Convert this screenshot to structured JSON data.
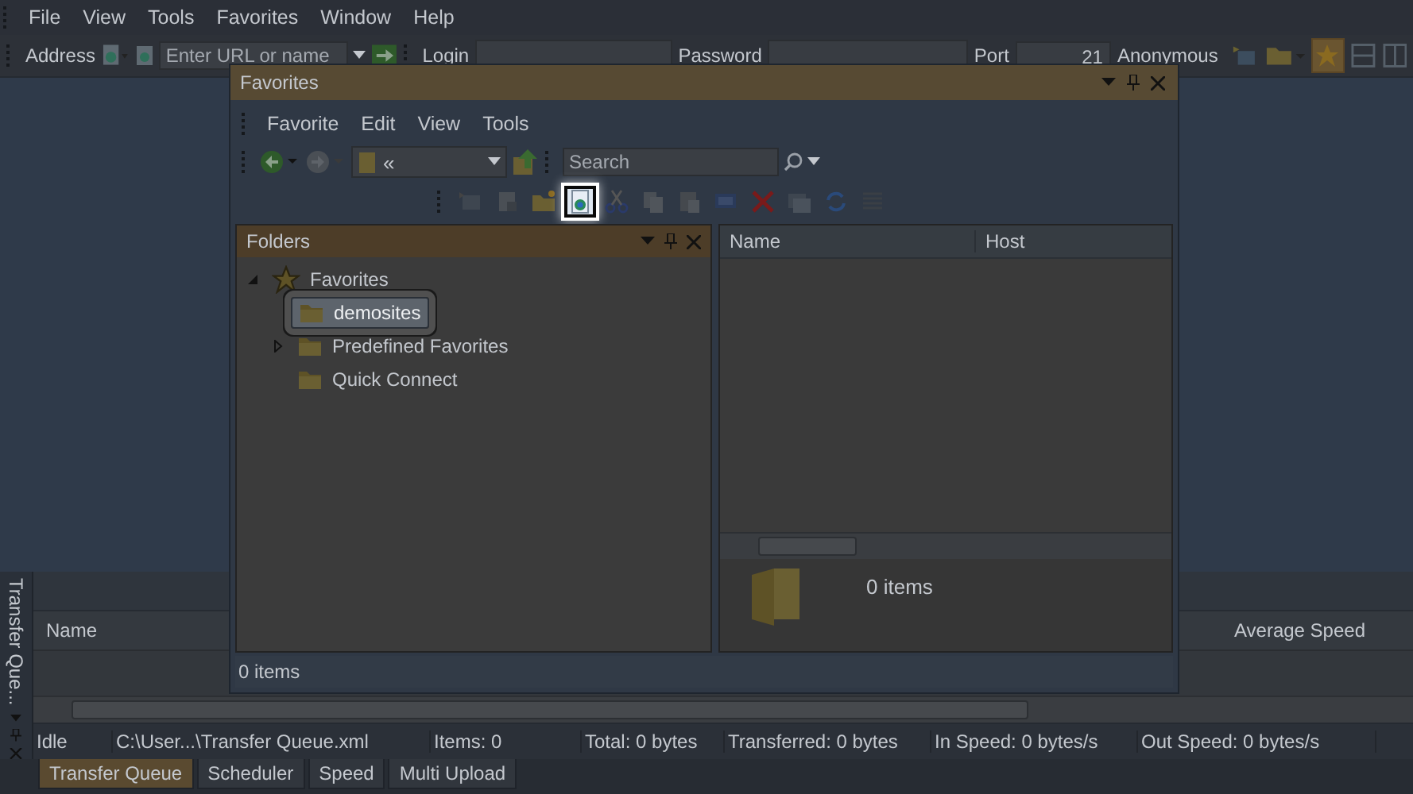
{
  "menu": [
    "File",
    "View",
    "Tools",
    "Favorites",
    "Window",
    "Help"
  ],
  "address_bar": {
    "label": "Address",
    "placeholder": "Enter URL or name",
    "login_label": "Login",
    "password_label": "Password",
    "port_label": "Port",
    "port": "21",
    "anonymous_label": "Anonymous"
  },
  "favorites_window": {
    "title": "Favorites",
    "menu": [
      "Favorite",
      "Edit",
      "View",
      "Tools"
    ],
    "path": "«",
    "search_placeholder": "Search",
    "toolbar": [
      {
        "kind": "connect",
        "highlighted": false
      },
      {
        "kind": "properties",
        "highlighted": false
      },
      {
        "kind": "new-folder",
        "highlighted": false
      },
      {
        "kind": "new-site",
        "highlighted": true
      },
      {
        "kind": "cut",
        "highlighted": false
      },
      {
        "kind": "copy",
        "highlighted": false
      },
      {
        "kind": "paste",
        "highlighted": false
      },
      {
        "kind": "monitor",
        "highlighted": false
      },
      {
        "kind": "delete",
        "highlighted": false
      },
      {
        "kind": "windows",
        "highlighted": false
      },
      {
        "kind": "refresh",
        "highlighted": false
      },
      {
        "kind": "view",
        "highlighted": false
      }
    ],
    "folders_title": "Folders",
    "tree": [
      {
        "label": "Favorites",
        "expanded": true,
        "selected": false,
        "children": [
          {
            "label": "demosites",
            "selected": true
          },
          {
            "label": "Predefined Favorites",
            "expanded": false,
            "selected": false
          },
          {
            "label": "Quick Connect",
            "selected": false
          }
        ]
      }
    ],
    "columns": [
      "Name",
      "Host"
    ],
    "preview_count": "0 items",
    "status": "0 items"
  },
  "transfer_queue": {
    "side_tab": "Transfer Que...",
    "columns": [
      "Name",
      "Average Speed"
    ],
    "status": [
      "Idle",
      "C:\\User...\\Transfer Queue.xml",
      "Items: 0",
      "Total: 0 bytes",
      "Transferred: 0 bytes",
      "In Speed: 0 bytes/s",
      "Out Speed: 0 bytes/s"
    ],
    "tabs": [
      {
        "label": "Transfer Queue",
        "selected": true
      },
      {
        "label": "Scheduler",
        "selected": false
      },
      {
        "label": "Speed",
        "selected": false
      },
      {
        "label": "Multi Upload",
        "selected": false
      }
    ]
  }
}
